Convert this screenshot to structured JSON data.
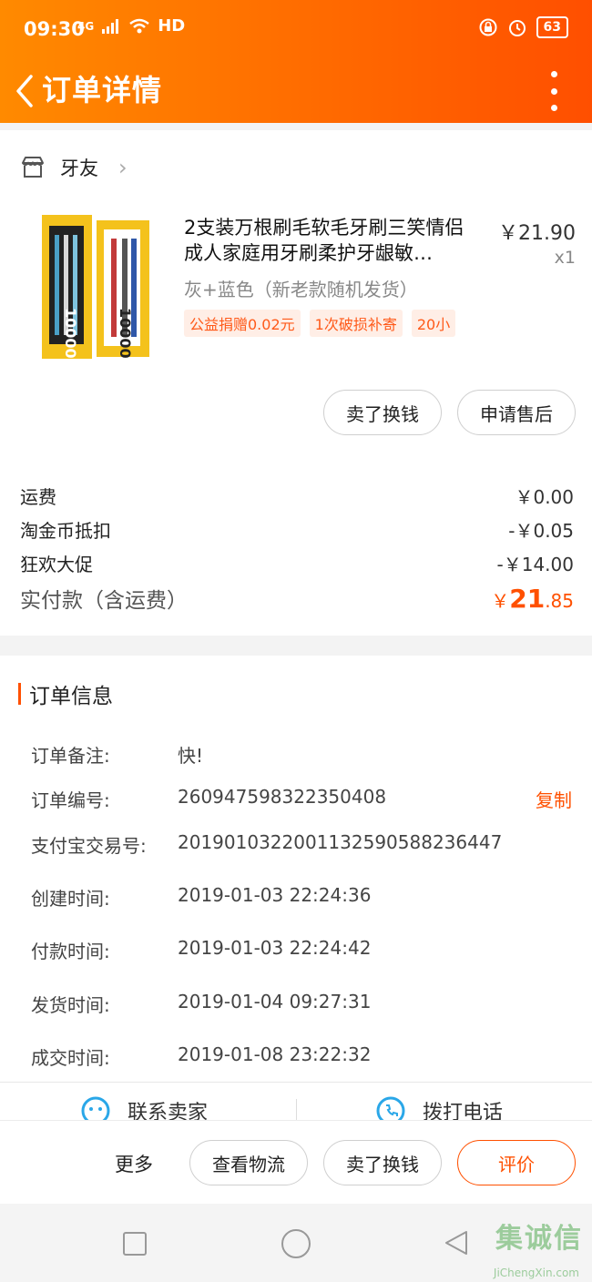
{
  "status_bar": {
    "time": "09:30",
    "network": "4G",
    "hd": "HD",
    "battery": "63"
  },
  "header": {
    "title": "订单详情"
  },
  "shop": {
    "name": "牙友"
  },
  "product": {
    "title": "2支装万根刷毛软毛牙刷三笑情侣成人家庭用牙刷柔护牙龈敏…",
    "price": "￥21.90",
    "qty": "x1",
    "spec": "灰+蓝色（新老款随机发货）",
    "tags": [
      "公益捐赠0.02元",
      "1次破损补寄",
      "20小"
    ],
    "image_text": "10000"
  },
  "item_actions": {
    "sell": "卖了换钱",
    "after_sale": "申请售后"
  },
  "fees": [
    {
      "label": "运费",
      "value": "￥0.00"
    },
    {
      "label": "淘金币抵扣",
      "value": "-￥0.05"
    },
    {
      "label": "狂欢大促",
      "value": "-￥14.00"
    }
  ],
  "total": {
    "label": "实付款（含运费）",
    "currency": "￥",
    "int": "21",
    "dec": ".85"
  },
  "order_info": {
    "title": "订单信息",
    "rows": [
      {
        "label": "订单备注:",
        "value": "快!"
      },
      {
        "label": "订单编号:",
        "value": "260947598322350408",
        "action": "复制"
      },
      {
        "label": "支付宝交易号:",
        "value": "2019010322001132590588236447"
      },
      {
        "label": "创建时间:",
        "value": "2019-01-03 22:24:36"
      },
      {
        "label": "付款时间:",
        "value": "2019-01-03 22:24:42"
      },
      {
        "label": "发货时间:",
        "value": "2019-01-04 09:27:31"
      },
      {
        "label": "成交时间:",
        "value": "2019-01-08 23:22:32"
      }
    ]
  },
  "contact": {
    "seller": "联系卖家",
    "call": "拨打电话"
  },
  "bottom_bar": {
    "more": "更多",
    "logistics": "查看物流",
    "sell": "卖了换钱",
    "review": "评价"
  },
  "watermark": {
    "main": "集诚信",
    "sub": "JiChengXin.com"
  },
  "colors": {
    "accent": "#ff5000",
    "header_start": "#ff8a00",
    "header_end": "#ff4f00"
  }
}
